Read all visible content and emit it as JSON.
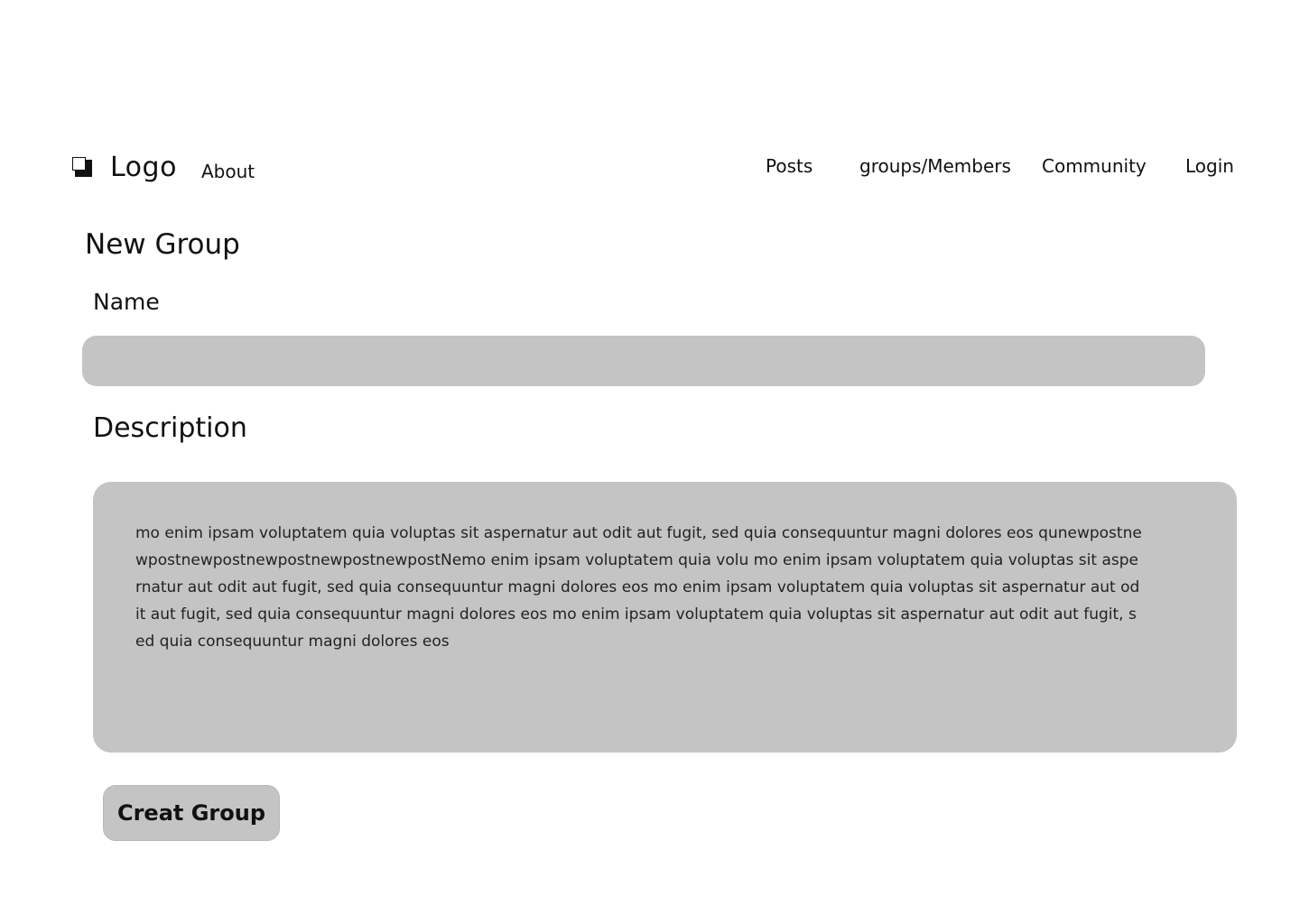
{
  "header": {
    "logo_icon": "logo-square-icon",
    "logo_text": "Logo",
    "about_label": "About",
    "nav": {
      "posts": "Posts",
      "groups_members": "groups/Members",
      "community": "Community",
      "login": "Login"
    }
  },
  "form": {
    "title": "New Group",
    "name_label": "Name",
    "name_value": "",
    "description_label": "Description",
    "description_value": "mo enim ipsam voluptatem quia voluptas sit aspernatur aut odit aut fugit, sed quia consequuntur magni dolores eos qunewpostnewpostnewpostnewpostnewpostnewpostNemo enim ipsam voluptatem quia volu mo enim ipsam voluptatem quia voluptas sit aspernatur aut odit aut fugit, sed quia consequuntur magni dolores eos mo enim ipsam voluptatem quia voluptas sit aspernatur aut odit aut fugit, sed quia consequuntur magni dolores eos  mo enim ipsam voluptatem quia voluptas sit aspernatur aut odit aut fugit, sed quia consequuntur magni dolores eos",
    "submit_label": "Creat Group"
  },
  "colors": {
    "field_background": "#c4c4c4",
    "text": "#111111"
  }
}
